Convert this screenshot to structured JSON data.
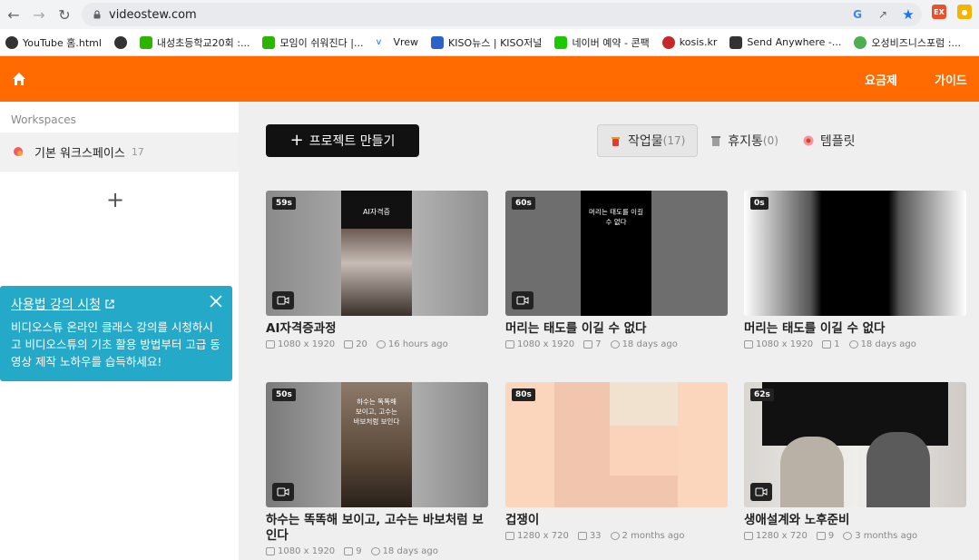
{
  "browser": {
    "url": "videostew.com",
    "bookmarks": [
      "YouTube 홈.html",
      "",
      "내성초등학교20회 :...",
      "모임이 쉬워진다 |...",
      "Vrew",
      "KISO뉴스 | KISO저널",
      "네이버 예약 - 콘팩",
      "kosis.kr",
      "Send Anywhere -...",
      "오성비즈니스포럼 :..."
    ],
    "ext_label": "EX"
  },
  "header": {
    "pricing": "요금제",
    "guide": "가이드"
  },
  "sidebar": {
    "section_label": "Workspaces",
    "workspace_name": "기본 워크스페이스",
    "workspace_count": "17",
    "add_label": "+"
  },
  "tip": {
    "title": "사용법 강의 시청",
    "body": "비디오스튜 온라인 클래스 강의를 시청하시고 비디오스튜의 기초 활용 방법부터 고급 동영상 제작 노하우를 습득하세요!"
  },
  "toolbar": {
    "new_project": "프로젝트 만들기",
    "tabs": [
      {
        "label": "작업물",
        "count": "(17)"
      },
      {
        "label": "휴지통",
        "count": "(0)"
      },
      {
        "label": "템플릿",
        "count": ""
      }
    ]
  },
  "projects": [
    {
      "title": "AI자격증과정",
      "duration": "59s",
      "size": "1080 x 1920",
      "scenes": "20",
      "updated": "16 hours ago",
      "overlay": "AI자격증"
    },
    {
      "title": "머리는 태도를 이길 수 없다",
      "duration": "60s",
      "size": "1080 x 1920",
      "scenes": "7",
      "updated": "18 days ago",
      "overlay": "머리는 태도를 이길\n수 없다"
    },
    {
      "title": "머리는 태도를 이길 수 없다",
      "duration": "0s",
      "size": "1080 x 1920",
      "scenes": "1",
      "updated": "18 days ago",
      "overlay": ""
    },
    {
      "title": "하수는 똑똑해 보이고, 고수는 바보처럼 보인다",
      "duration": "50s",
      "size": "1080 x 1920",
      "scenes": "9",
      "updated": "18 days ago",
      "overlay": "하수는 똑똑해\n보이고, 고수는\n바보처럼 보인다"
    },
    {
      "title": "겁쟁이",
      "duration": "80s",
      "size": "1280 x 720",
      "scenes": "33",
      "updated": "2 months ago",
      "overlay": ""
    },
    {
      "title": "생애설계와 노후준비",
      "duration": "62s",
      "size": "1280 x 720",
      "scenes": "9",
      "updated": "3 months ago",
      "overlay": ""
    }
  ],
  "colors": {
    "brand": "#ff6b00",
    "tip": "#24a9c8"
  }
}
